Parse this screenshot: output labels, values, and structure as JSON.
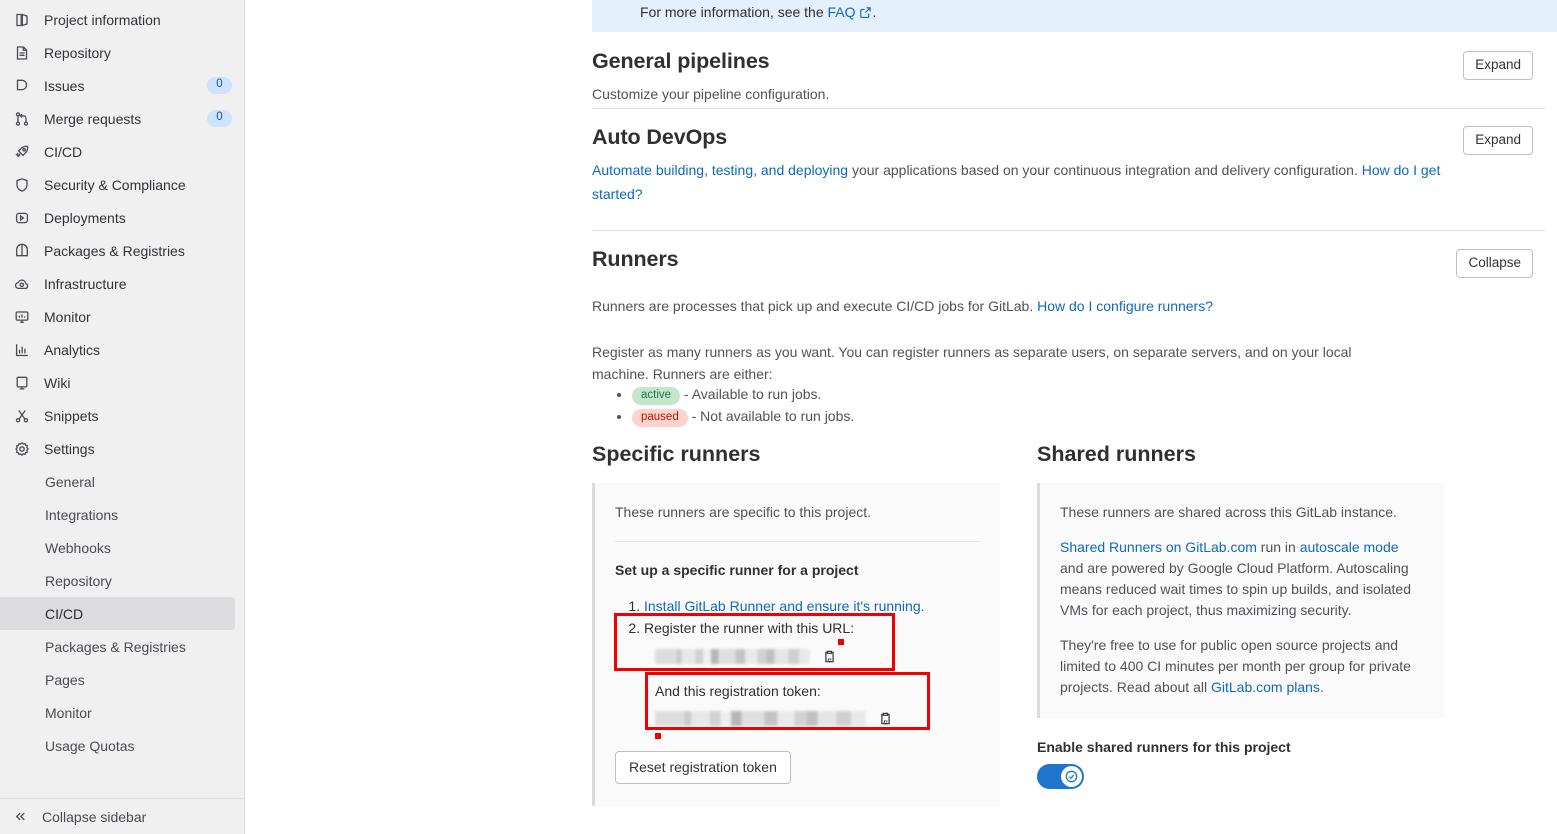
{
  "sidebar": {
    "items": [
      {
        "label": "Project information",
        "icon": "project-information-icon",
        "badge": null
      },
      {
        "label": "Repository",
        "icon": "repository-icon",
        "badge": null
      },
      {
        "label": "Issues",
        "icon": "issues-icon",
        "badge": "0"
      },
      {
        "label": "Merge requests",
        "icon": "merge-requests-icon",
        "badge": "0"
      },
      {
        "label": "CI/CD",
        "icon": "rocket-icon",
        "badge": null
      },
      {
        "label": "Security & Compliance",
        "icon": "shield-icon",
        "badge": null
      },
      {
        "label": "Deployments",
        "icon": "deployments-icon",
        "badge": null
      },
      {
        "label": "Packages & Registries",
        "icon": "package-icon",
        "badge": null
      },
      {
        "label": "Infrastructure",
        "icon": "cloud-gear-icon",
        "badge": null
      },
      {
        "label": "Monitor",
        "icon": "monitor-icon",
        "badge": null
      },
      {
        "label": "Analytics",
        "icon": "analytics-icon",
        "badge": null
      },
      {
        "label": "Wiki",
        "icon": "wiki-icon",
        "badge": null
      },
      {
        "label": "Snippets",
        "icon": "snippets-icon",
        "badge": null
      },
      {
        "label": "Settings",
        "icon": "gear-icon",
        "badge": null
      }
    ],
    "settings_subitems": [
      {
        "label": "General",
        "active": false
      },
      {
        "label": "Integrations",
        "active": false
      },
      {
        "label": "Webhooks",
        "active": false
      },
      {
        "label": "Repository",
        "active": false
      },
      {
        "label": "CI/CD",
        "active": true
      },
      {
        "label": "Packages & Registries",
        "active": false
      },
      {
        "label": "Pages",
        "active": false
      },
      {
        "label": "Monitor",
        "active": false
      },
      {
        "label": "Usage Quotas",
        "active": false
      }
    ],
    "collapse_label": "Collapse sidebar"
  },
  "banner": {
    "text_before": "For more information, see the ",
    "link": "FAQ",
    "text_after": "."
  },
  "general_pipelines": {
    "title": "General pipelines",
    "subtitle": "Customize your pipeline configuration.",
    "button": "Expand"
  },
  "auto_devops": {
    "title": "Auto DevOps",
    "link1": "Automate building, testing, and deploying",
    "body_middle": " your applications based on your continuous integration and delivery configuration. ",
    "link2": "How do I get started?",
    "button": "Expand"
  },
  "runners": {
    "title": "Runners",
    "button": "Collapse",
    "intro_text": "Runners are processes that pick up and execute CI/CD jobs for GitLab. ",
    "intro_link": "How do I configure runners?",
    "register_text": "Register as many runners as you want. You can register runners as separate users, on separate servers, and on your local machine. Runners are either:",
    "states": [
      {
        "badge": "active",
        "badge_type": "active",
        "description": " - Available to run jobs."
      },
      {
        "badge": "paused",
        "badge_type": "paused",
        "description": " - Not available to run jobs."
      }
    ],
    "specific": {
      "title": "Specific runners",
      "description": "These runners are specific to this project.",
      "setup_title": "Set up a specific runner for a project",
      "step1_link": "Install GitLab Runner and ensure it's running.",
      "step2_text": "Register the runner with this URL:",
      "url_value": "",
      "token_label": "And this registration token:",
      "token_value": "",
      "reset_button": "Reset registration token"
    },
    "shared": {
      "title": "Shared runners",
      "p1": "These runners are shared across this GitLab instance.",
      "p2_link1": "Shared Runners on GitLab.com",
      "p2_mid1": " run in ",
      "p2_link2": "autoscale mode",
      "p2_rest": " and are powered by Google Cloud Platform. Autoscaling means reduced wait times to spin up builds, and isolated VMs for each project, thus maximizing security.",
      "p3_text": "They're free to use for public open source projects and limited to 400 CI minutes per month per group for private projects. Read about all ",
      "p3_link": "GitLab.com plans",
      "p3_end": ".",
      "toggle_label": "Enable shared runners for this project",
      "toggle_state": "on"
    }
  },
  "colors": {
    "link": "#1068bf",
    "banner_bg": "#e4f0fb",
    "highlight_box": "#f00000",
    "toggle_on": "#1f75cb",
    "badge_active_bg": "#c3e6cd",
    "badge_paused_bg": "#fdd4cd",
    "sidebar_bg": "#f0f0f0",
    "active_item_bg": "#dcdcde"
  }
}
